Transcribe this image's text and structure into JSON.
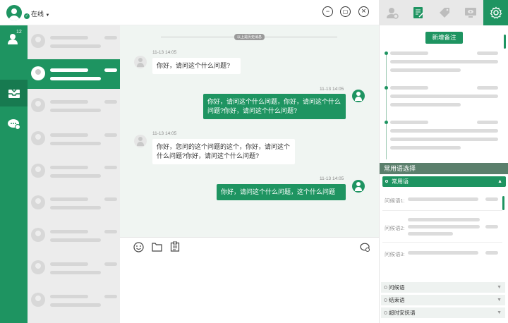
{
  "header": {
    "status": "在线",
    "minimize_glyph": "−",
    "maximize_glyph": "▢",
    "close_glyph": "×"
  },
  "rail": {
    "badge": "12"
  },
  "chat": {
    "history_label": "以上是历史消息",
    "messages": [
      {
        "side": "left",
        "time": "11-13 14:05",
        "text": "你好，请问这个什么问题?"
      },
      {
        "side": "right",
        "time": "11-13 14:05",
        "text": "你好，请问这个什么问题，你好，请问这个什么问题?你好，请问这个什么问题?"
      },
      {
        "side": "left",
        "time": "11-13 14:05",
        "text": "你好，您问的这个问题的这个，你好，请问这个什么问题?你好，请问这个什么问题?"
      },
      {
        "side": "right",
        "time": "11-13 14:05",
        "text": "你好，请问这个什么问题，这个什么问题"
      }
    ]
  },
  "right": {
    "add_note_label": "新增备注",
    "phrases_title": "常用语选择",
    "common_label": "常用语",
    "greetings": [
      "问候语1:",
      "问候语2:",
      "问候语3:"
    ],
    "collapsed": [
      "问候语",
      "结束语",
      "超时安抚语"
    ]
  },
  "colors": {
    "brand": "#1e9461",
    "phrase_header": "#5b7f6c"
  }
}
